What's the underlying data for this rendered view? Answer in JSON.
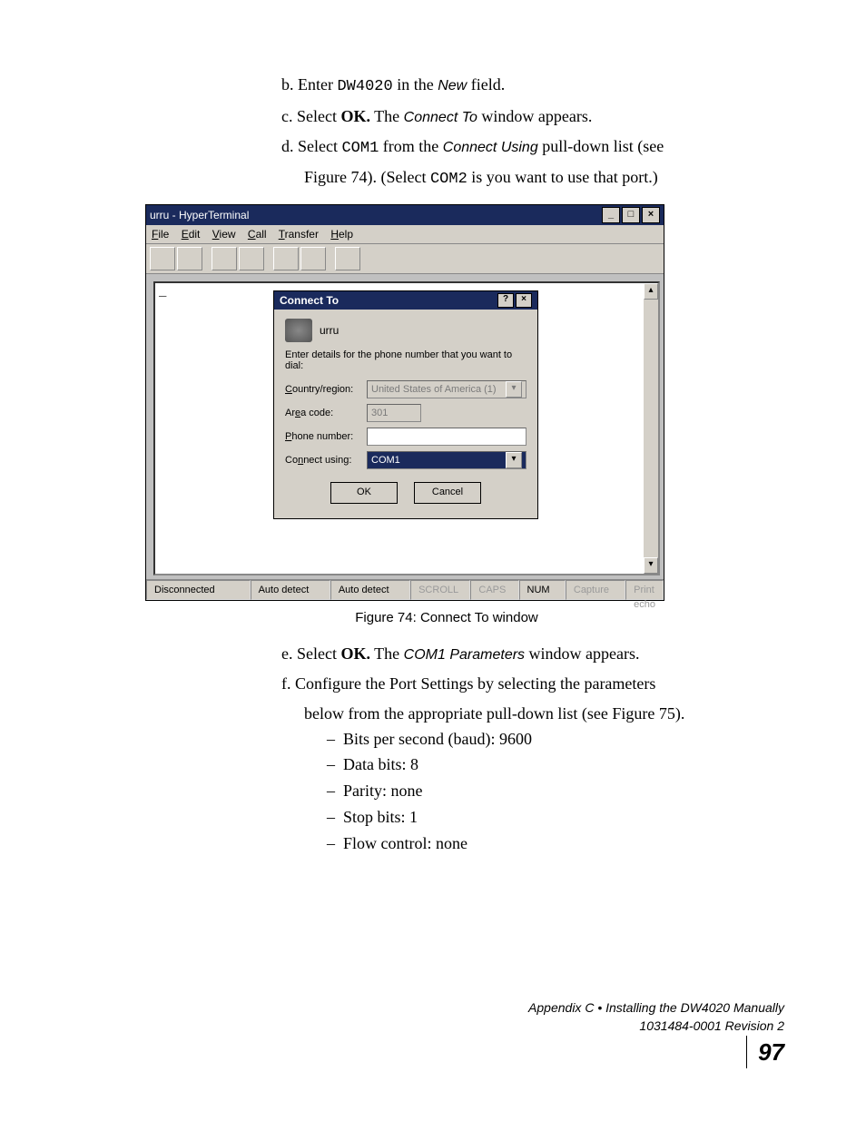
{
  "steps": {
    "b": {
      "prefix": "b. Enter ",
      "code": "DW4020",
      "mid": " in the ",
      "ital": "New",
      "suffix": " field."
    },
    "c": {
      "prefix": "c. Select ",
      "bold": "OK.",
      "mid": " The ",
      "ital": "Connect To",
      "suffix": " window appears."
    },
    "d": {
      "prefix": "d. Select ",
      "code": "COM1",
      "mid": " from the ",
      "ital": "Connect Using",
      "suffix": " pull-down list (see"
    },
    "d2": {
      "text": "Figure 74). (Select ",
      "code": "COM2",
      "suffix": "  is you want to use that port.)"
    },
    "e": {
      "prefix": "e. Select ",
      "bold": "OK.",
      "mid": " The ",
      "ital": "COM1 Parameters",
      "suffix": " window appears."
    },
    "f": {
      "prefix": "f.  Configure the Port Settings by selecting the parameters"
    },
    "f2": {
      "text": "below from the appropriate pull-down list (see Figure 75)."
    }
  },
  "bullets": [
    {
      "label": "Bits per second (baud): 9600"
    },
    {
      "label": "Data bits: 8"
    },
    {
      "label": "Parity: none"
    },
    {
      "label": "Stop bits: 1"
    },
    {
      "label": "Flow control: none"
    }
  ],
  "figure_caption": "Figure 74:  Connect To window",
  "ht": {
    "app_title": "urru - HyperTerminal",
    "menus": {
      "file": "File",
      "edit": "Edit",
      "view": "View",
      "call": "Call",
      "transfer": "Transfer",
      "help": "Help"
    },
    "dialog": {
      "title": "Connect To",
      "icon_label": "urru",
      "instruction": "Enter details for the phone number that you want to dial:",
      "country_label": "Country/region:",
      "country_value": "United States of America (1)",
      "area_label": "Area code:",
      "area_value": "301",
      "phone_label": "Phone number:",
      "phone_value": "",
      "connect_label": "Connect using:",
      "connect_value": "COM1",
      "ok": "OK",
      "cancel": "Cancel"
    },
    "status": {
      "conn": "Disconnected",
      "detect1": "Auto detect",
      "detect2": "Auto detect",
      "scroll": "SCROLL",
      "caps": "CAPS",
      "num": "NUM",
      "capture": "Capture",
      "print": "Print echo"
    }
  },
  "footer": {
    "line1": "Appendix C • Installing the DW4020 Manually",
    "line2": "1031484-0001  Revision 2",
    "page": "97"
  }
}
